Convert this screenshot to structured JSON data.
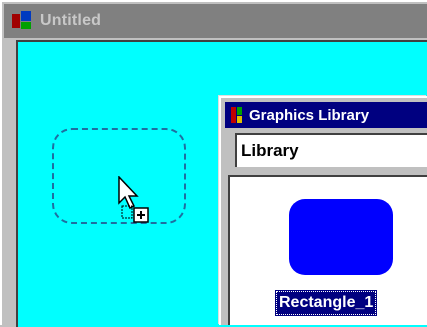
{
  "main_window": {
    "title": "Untitled"
  },
  "graphics_library": {
    "title": "Graphics Library",
    "library_field": "Library",
    "selected_item": {
      "label": "Rectangle_1",
      "shape": "rounded-rectangle",
      "fill_color": "#0000ff"
    }
  },
  "canvas": {
    "background_color": "#00ffff",
    "drag_cursor": "arrow-with-plus-icon"
  }
}
